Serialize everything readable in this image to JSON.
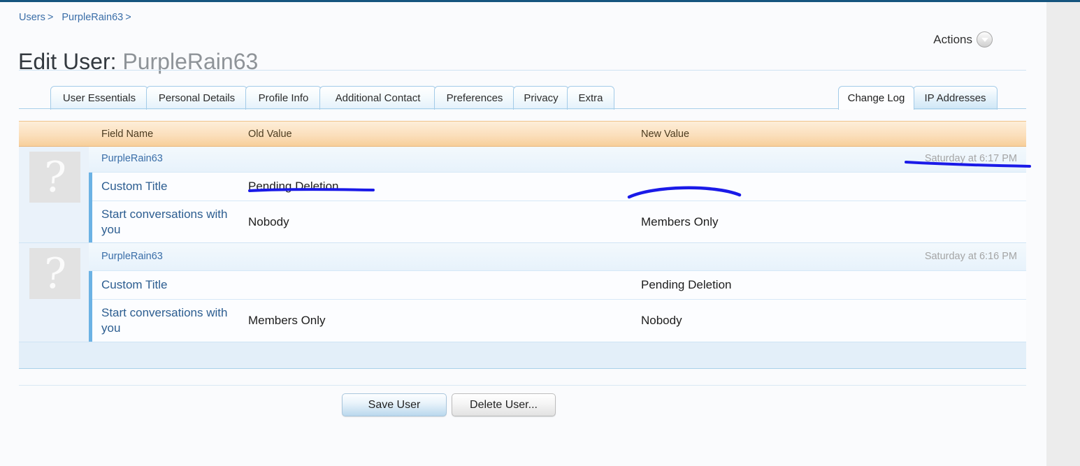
{
  "breadcrumb": {
    "items": [
      {
        "label": "Users",
        "separator": ">"
      },
      {
        "label": "PurpleRain63",
        "separator": ">"
      }
    ]
  },
  "header": {
    "title_prefix": "Edit User:",
    "title_username": "PurpleRain63",
    "actions_label": "Actions",
    "actions_icon": "chevron-down-circle-icon"
  },
  "tabs": {
    "left": [
      {
        "label": "User Essentials"
      },
      {
        "label": "Personal Details"
      },
      {
        "label": "Profile Info"
      },
      {
        "label": "Additional Contact"
      },
      {
        "label": "Preferences"
      },
      {
        "label": "Privacy"
      },
      {
        "label": "Extra"
      }
    ],
    "right": [
      {
        "label": "Change Log",
        "active": true
      },
      {
        "label": "IP Addresses",
        "active": false
      }
    ]
  },
  "change_log": {
    "columns": {
      "field_name": "Field Name",
      "old_value": "Old Value",
      "new_value": "New Value"
    },
    "groups": [
      {
        "avatar_glyph": "?",
        "username": "PurpleRain63",
        "timestamp": "Saturday at 6:17 PM",
        "rows": [
          {
            "field": "Custom Title",
            "old": "Pending Deletion",
            "new": ""
          },
          {
            "field": "Start conversations with you",
            "old": "Nobody",
            "new": "Members Only"
          }
        ]
      },
      {
        "avatar_glyph": "?",
        "username": "PurpleRain63",
        "timestamp": "Saturday at 6:16 PM",
        "rows": [
          {
            "field": "Custom Title",
            "old": "",
            "new": "Pending Deletion"
          },
          {
            "field": "Start conversations with you",
            "old": "Members Only",
            "new": "Nobody"
          }
        ]
      }
    ]
  },
  "footer": {
    "save_label": "Save User",
    "delete_label": "Delete User..."
  },
  "annotations": {
    "ink_color": "#1a1ae8",
    "marks": [
      {
        "name": "underline-old-custom-title",
        "type": "underline"
      },
      {
        "name": "arc-over-new-members-only",
        "type": "arc"
      },
      {
        "name": "underline-timestamp",
        "type": "underline"
      }
    ]
  },
  "colors": {
    "top_rule": "#15557f",
    "link": "#3a6ea8",
    "table_header": "#fbdfbc",
    "row_accent": "#6cb2e4",
    "page_background": "#fafbfd"
  }
}
